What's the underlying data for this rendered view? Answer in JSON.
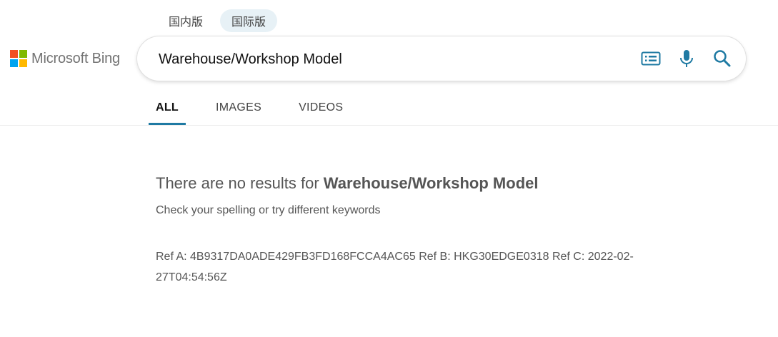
{
  "region_tabs": [
    {
      "label": "国内版",
      "active": false
    },
    {
      "label": "国际版",
      "active": true
    }
  ],
  "brand": {
    "name": "Microsoft Bing",
    "logo_colors": [
      "#f25022",
      "#7fba00",
      "#00a4ef",
      "#ffb900"
    ]
  },
  "search": {
    "value": "Warehouse/Workshop Model",
    "icons": [
      "keyboard-icon",
      "microphone-icon",
      "search-icon"
    ],
    "icon_color": "#1f7aa3"
  },
  "scope_tabs": [
    {
      "label": "ALL",
      "active": true
    },
    {
      "label": "IMAGES",
      "active": false
    },
    {
      "label": "VIDEOS",
      "active": false
    }
  ],
  "results": {
    "no_results_prefix": "There are no results for ",
    "query": "Warehouse/Workshop Model",
    "hint": "Check your spelling or try different keywords",
    "ref": "Ref A: 4B9317DA0ADE429FB3FD168FCCA4AC65 Ref B: HKG30EDGE0318 Ref C: 2022-02-27T04:54:56Z"
  }
}
